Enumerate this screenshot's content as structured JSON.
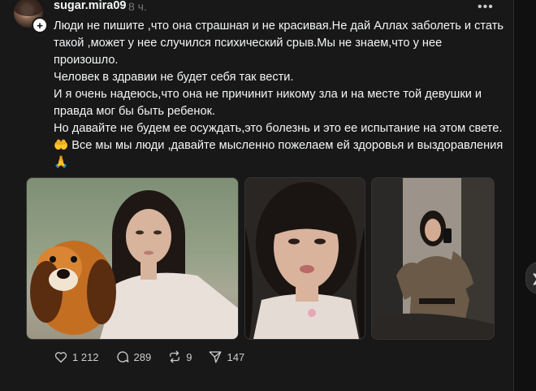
{
  "post": {
    "username": "sugar.mira09",
    "timestamp": "8 ч.",
    "text_lines": [
      "Люди не пишите ,что она страшная и не красивая.Не дай Аллах заболеть и стать такой ,может у нее случился психический срыв.Мы не знаем,что у нее произошло.",
      "Человек в здравии не будет себя так вести.",
      "И я очень надеюсь,что она не причинит никому зла и на месте той девушки и правда мог бы быть ребенок.",
      "Но давайте не будем ее осуждать,это болезнь и это ее испытание на этом свете.🤲 Все мы мы люди ,давайте мысленно пожелаем ей здоровья и выздоравления 🙏"
    ],
    "photos": [
      {
        "name": "photo-selfie-with-plush-dog"
      },
      {
        "name": "photo-closeup-face"
      },
      {
        "name": "photo-mirror-selfie"
      }
    ],
    "actions": {
      "likes": "1 212",
      "comments": "289",
      "reposts": "9",
      "shares": "147"
    }
  },
  "icons": {
    "more": "more-icon",
    "like": "heart-icon",
    "comment": "comment-icon",
    "repost": "repost-icon",
    "share": "send-icon",
    "next": "chevron-right-icon"
  }
}
